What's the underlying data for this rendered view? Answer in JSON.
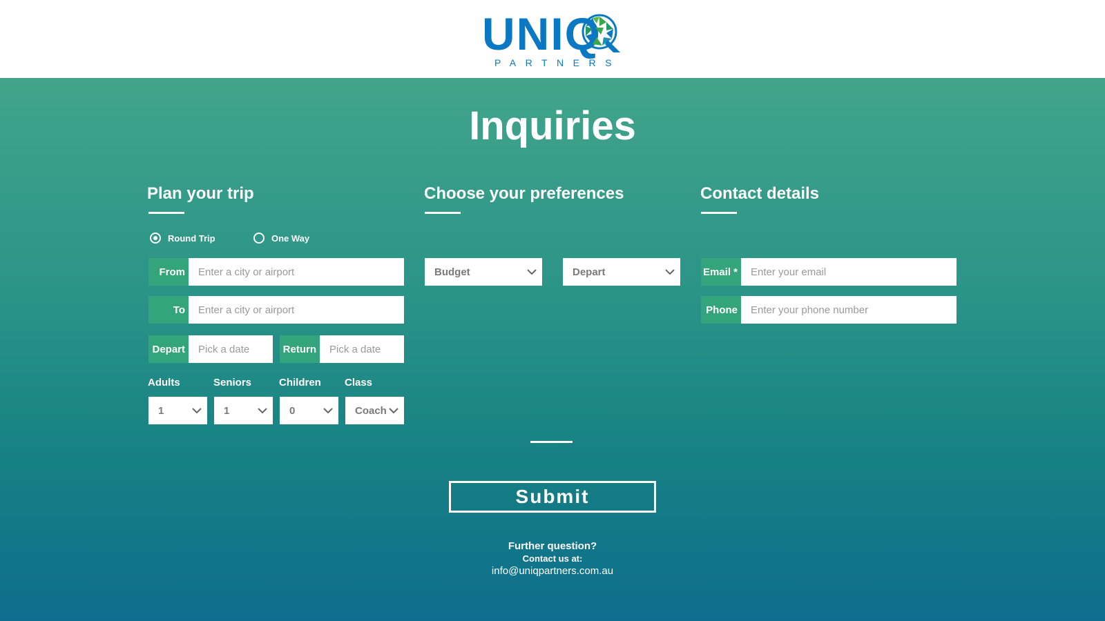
{
  "brand": {
    "logo_text": "UNIQ",
    "logo_sub": "PARTNERS"
  },
  "page_title": "Inquiries",
  "sections": {
    "trip": "Plan your trip",
    "preferences": "Choose your preferences",
    "contact": "Contact details"
  },
  "trip": {
    "round_trip": "Round Trip",
    "one_way": "One Way",
    "from_label": "From",
    "from_placeholder": "Enter a city or airport",
    "to_label": "To",
    "to_placeholder": "Enter a city or airport",
    "depart_label": "Depart",
    "depart_placeholder": "Pick a date",
    "return_label": "Return",
    "return_placeholder": "Pick a date",
    "adults_label": "Adults",
    "adults_value": "1",
    "seniors_label": "Seniors",
    "seniors_value": "1",
    "children_label": "Children",
    "children_value": "0",
    "class_label": "Class",
    "class_value": "Coach"
  },
  "preferences": {
    "budget": "Budget",
    "depart": "Depart"
  },
  "contact": {
    "email_label": "Email *",
    "email_placeholder": "Enter your email",
    "phone_label": "Phone",
    "phone_placeholder": "Enter your phone number"
  },
  "submit_label": "Submit",
  "footer": {
    "question": "Further question?",
    "contact_us": "Contact us at:",
    "email": "info@uniqpartners.com.au"
  },
  "colors": {
    "brand_blue": "#0a78c2",
    "brand_green": "#2ea37a",
    "label_green": "#33a47c"
  }
}
